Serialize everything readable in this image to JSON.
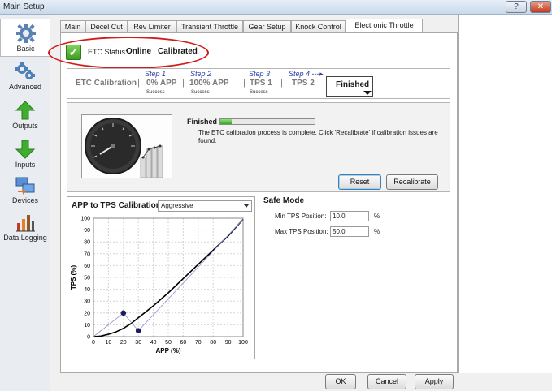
{
  "window": {
    "title": "Main Setup",
    "help_label": "?",
    "close_label": "✕"
  },
  "sidebar": {
    "items": [
      {
        "label": "Basic",
        "icon": "gear-icon"
      },
      {
        "label": "Advanced",
        "icon": "gears-icon"
      },
      {
        "label": "Outputs",
        "icon": "arrow-up-icon"
      },
      {
        "label": "Inputs",
        "icon": "arrow-down-icon"
      },
      {
        "label": "Devices",
        "icon": "devices-icon"
      },
      {
        "label": "Data Logging",
        "icon": "chart-icon"
      }
    ]
  },
  "tabs": [
    {
      "label": "Main"
    },
    {
      "label": "Decel Cut"
    },
    {
      "label": "Rev Limiter"
    },
    {
      "label": "Transient Throttle"
    },
    {
      "label": "Gear Setup"
    },
    {
      "label": "Knock Control"
    },
    {
      "label": "Electronic Throttle"
    }
  ],
  "status": {
    "label": "ETC Status:",
    "online": "Online",
    "calibrated": "Calibrated"
  },
  "wizard": {
    "start": "ETC Calibration",
    "sep": "|",
    "steps": [
      {
        "title": "Step 1",
        "label": "0% APP",
        "result": "Success"
      },
      {
        "title": "Step 2",
        "label": "100% APP",
        "result": "Success"
      },
      {
        "title": "Step 3",
        "label": "TPS 1",
        "result": "Success"
      },
      {
        "title": "Step 4 ---▸",
        "label": "TPS 2",
        "result": ""
      }
    ],
    "finished": "Finished"
  },
  "progress": {
    "label": "Finished",
    "value": 0.12,
    "message": "The ETC calibration process is complete. Click 'Recalibrate' if calibration issues are found.",
    "reset_label": "Reset",
    "recalibrate_label": "Recalibrate"
  },
  "calibration": {
    "title": "APP to TPS Calibration",
    "mode": "Aggressive"
  },
  "chart_data": {
    "type": "line",
    "title": "",
    "xlabel": "APP (%)",
    "ylabel": "TPS (%)",
    "xlim": [
      0,
      100
    ],
    "ylim": [
      0,
      100
    ],
    "xticks": [
      0,
      10,
      20,
      30,
      40,
      50,
      60,
      70,
      80,
      90,
      100
    ],
    "yticks": [
      0,
      10,
      20,
      30,
      40,
      50,
      60,
      70,
      80,
      90,
      100
    ],
    "grid": true,
    "series": [
      {
        "style": "solid",
        "color": "#000000",
        "x": [
          0,
          5,
          10,
          15,
          20,
          25,
          30,
          35,
          40,
          50,
          60,
          70,
          80,
          90,
          100
        ],
        "y": [
          0,
          0.5,
          2,
          4,
          7,
          11,
          16,
          21,
          26,
          37,
          49,
          61,
          73,
          85,
          99
        ]
      },
      {
        "style": "thin",
        "color": "#8a8fd0",
        "x": [
          0,
          20,
          30,
          100
        ],
        "y": [
          0,
          20,
          5,
          99
        ]
      }
    ],
    "points": [
      {
        "x": 20,
        "y": 20,
        "color": "#1a1f5a"
      },
      {
        "x": 30,
        "y": 5,
        "color": "#1a1f5a"
      }
    ]
  },
  "safe_mode": {
    "title": "Safe Mode",
    "min_label": "Min TPS Position:",
    "min_value": "10.0",
    "max_label": "Max TPS Position:",
    "max_value": "50.0",
    "unit": "%"
  },
  "footer": {
    "ok_label": "OK",
    "cancel_label": "Cancel",
    "apply_label": "Apply"
  }
}
